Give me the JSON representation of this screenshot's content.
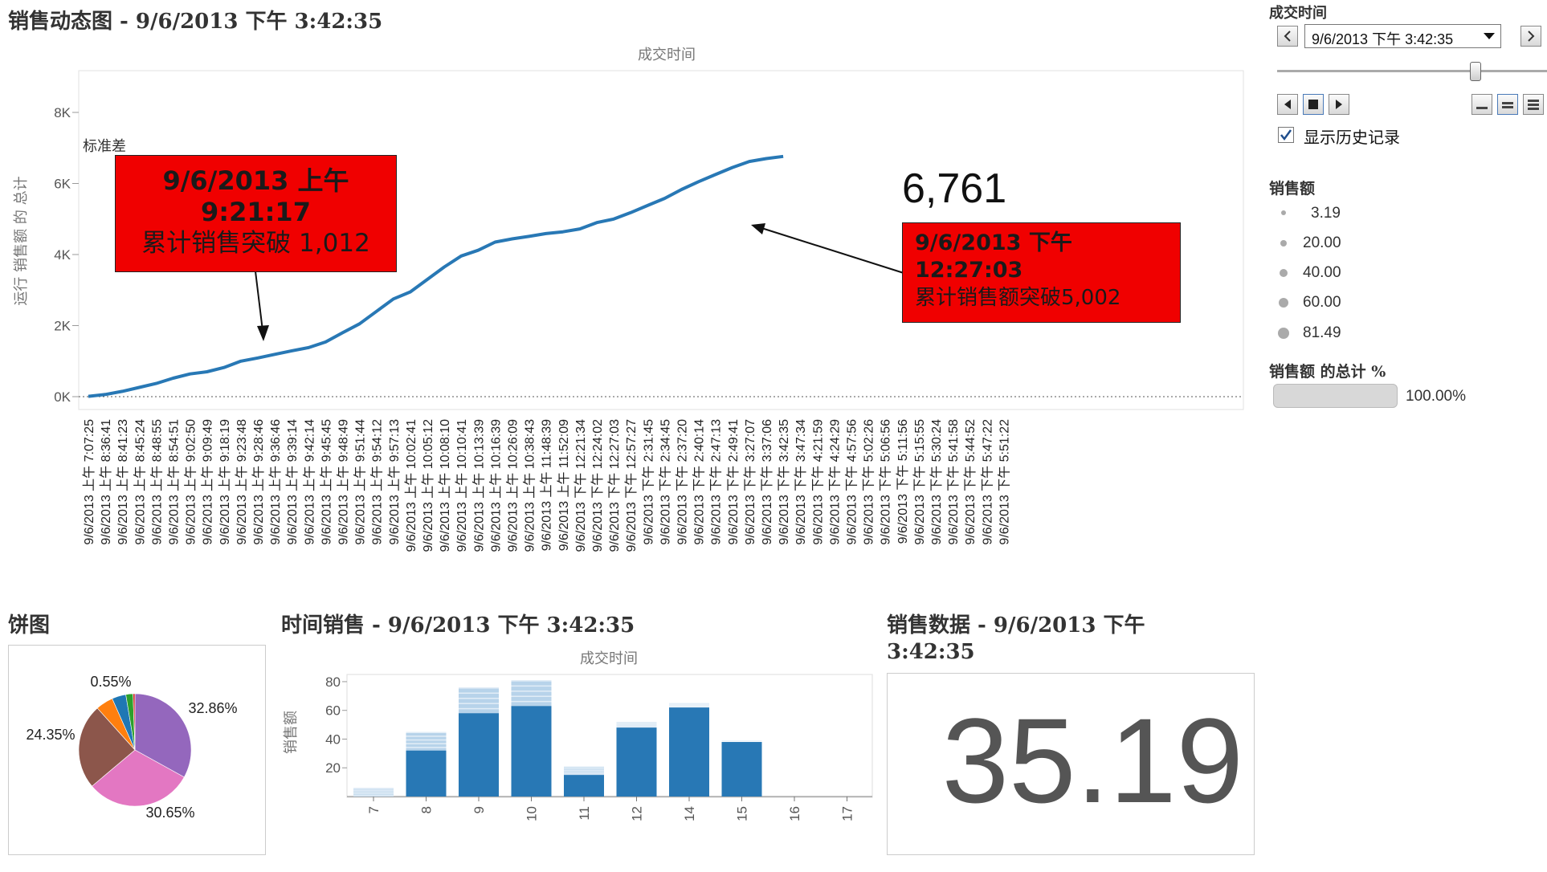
{
  "header": {
    "title": "销售动态图 - 9/6/2013 下午 3:42:35"
  },
  "main_chart": {
    "top_axis_title": "成交时间",
    "y_axis_title": "运行 销售额 的 总计",
    "table_calc_label": "标准差",
    "end_value_label": "6,761",
    "annotation_left": {
      "line1": "9/6/2013 上午",
      "line2": "9:21:17",
      "line3": "累计销售突破 1,012"
    },
    "annotation_right": {
      "line1": "9/6/2013 下午",
      "line2": "12:27:03",
      "line3": "累计销售额突破5,002"
    }
  },
  "controls": {
    "label": "成交时间",
    "selected_value": "9/6/2013 下午 3:42:35",
    "show_history_label": "显示历史记录",
    "show_history_checked": true
  },
  "size_legend": {
    "title": "销售额",
    "items": [
      "3.19",
      "20.00",
      "40.00",
      "60.00",
      "81.49"
    ]
  },
  "color_legend": {
    "title": "销售额 的总计 %",
    "value": "100.00%"
  },
  "pie_panel": {
    "title": "饼图"
  },
  "bar_panel": {
    "title": "时间销售 - 9/6/2013 下午 3:42:35",
    "axis_title": "成交时间",
    "y_axis_title": "销售额"
  },
  "kpi_panel": {
    "title_line1": "销售数据 - 9/6/2013 下午",
    "title_line2": "3:42:35",
    "value": "35.19"
  },
  "chart_data": [
    {
      "type": "line",
      "title": "销售动态图 - 9/6/2013 下午 3:42:35",
      "xlabel": "成交时间",
      "ylabel": "运行 销售额 的 总计",
      "ylim": [
        0,
        8000
      ],
      "y_ticks": [
        "0K",
        "2K",
        "4K",
        "6K",
        "8K"
      ],
      "x_categories": [
        "9/6/2013 上午 7:07:25",
        "9/6/2013 上午 8:36:41",
        "9/6/2013 上午 8:41:23",
        "9/6/2013 上午 8:45:24",
        "9/6/2013 上午 8:48:55",
        "9/6/2013 上午 8:54:51",
        "9/6/2013 上午 9:02:50",
        "9/6/2013 上午 9:09:49",
        "9/6/2013 上午 9:18:19",
        "9/6/2013 上午 9:23:48",
        "9/6/2013 上午 9:28:46",
        "9/6/2013 上午 9:36:46",
        "9/6/2013 上午 9:39:14",
        "9/6/2013 上午 9:42:14",
        "9/6/2013 上午 9:45:45",
        "9/6/2013 上午 9:48:49",
        "9/6/2013 上午 9:51:44",
        "9/6/2013 上午 9:54:12",
        "9/6/2013 上午 9:57:13",
        "9/6/2013 上午 10:02:41",
        "9/6/2013 上午 10:05:12",
        "9/6/2013 上午 10:08:10",
        "9/6/2013 上午 10:10:41",
        "9/6/2013 上午 10:13:39",
        "9/6/2013 上午 10:16:39",
        "9/6/2013 上午 10:26:09",
        "9/6/2013 上午 10:38:43",
        "9/6/2013 上午 11:48:39",
        "9/6/2013 上午 11:52:09",
        "9/6/2013 下午 12:21:34",
        "9/6/2013 下午 12:24:02",
        "9/6/2013 下午 12:27:03",
        "9/6/2013 下午 12:57:27",
        "9/6/2013 下午 2:31:45",
        "9/6/2013 下午 2:34:45",
        "9/6/2013 下午 2:37:20",
        "9/6/2013 下午 2:40:14",
        "9/6/2013 下午 2:47:13",
        "9/6/2013 下午 2:49:41",
        "9/6/2013 下午 3:27:07",
        "9/6/2013 下午 3:37:06",
        "9/6/2013 下午 3:42:35",
        "9/6/2013 下午 3:47:34",
        "9/6/2013 下午 4:21:59",
        "9/6/2013 下午 4:24:29",
        "9/6/2013 下午 4:57:56",
        "9/6/2013 下午 5:02:26",
        "9/6/2013 下午 5:06:56",
        "9/6/2013 下午 5:11:56",
        "9/6/2013 下午 5:15:55",
        "9/6/2013 下午 5:30:24",
        "9/6/2013 下午 5:41:58",
        "9/6/2013 下午 5:44:52",
        "9/6/2013 下午 5:47:22",
        "9/6/2013 下午 5:51:22"
      ],
      "series": [
        {
          "values": [
            10,
            60,
            150,
            260,
            370,
            520,
            640,
            700,
            820,
            1000,
            1090,
            1190,
            1290,
            1380,
            1540,
            1800,
            2050,
            2400,
            2750,
            2950,
            3300,
            3650,
            3960,
            4120,
            4350,
            4440,
            4510,
            4590,
            4640,
            4720,
            4900,
            5000,
            5180,
            5380,
            5580,
            5830,
            6050,
            6250,
            6450,
            6620,
            6700,
            6761
          ]
        }
      ]
    },
    {
      "type": "pie",
      "title": "饼图",
      "slices": [
        {
          "label": "32.86%",
          "value": 32.86,
          "color": "#9467bd"
        },
        {
          "label": "30.65%",
          "value": 30.65,
          "color": "#e377c2"
        },
        {
          "label": "24.35%",
          "value": 24.35,
          "color": "#8c564b"
        },
        {
          "label": "",
          "value": 5.0,
          "color": "#ff7f0e"
        },
        {
          "label": "",
          "value": 4.0,
          "color": "#1f77b4"
        },
        {
          "label": "",
          "value": 2.04,
          "color": "#2ca02c"
        },
        {
          "label": "0.55%",
          "value": 0.55,
          "color": "#d62728"
        }
      ]
    },
    {
      "type": "bar",
      "title": "时间销售 - 9/6/2013 下午 3:42:35",
      "xlabel": "成交时间",
      "ylabel": "销售额",
      "categories": [
        "7",
        "8",
        "9",
        "10",
        "11",
        "12",
        "14",
        "15",
        "16",
        "17"
      ],
      "values": [
        6,
        45,
        76,
        81,
        21,
        52,
        65,
        39,
        0,
        0
      ],
      "highlight_values": [
        0,
        32,
        58,
        63,
        15,
        48,
        62,
        38,
        0,
        0
      ],
      "ylim": [
        0,
        85
      ],
      "y_ticks": [
        "20",
        "40",
        "60",
        "80"
      ]
    }
  ]
}
